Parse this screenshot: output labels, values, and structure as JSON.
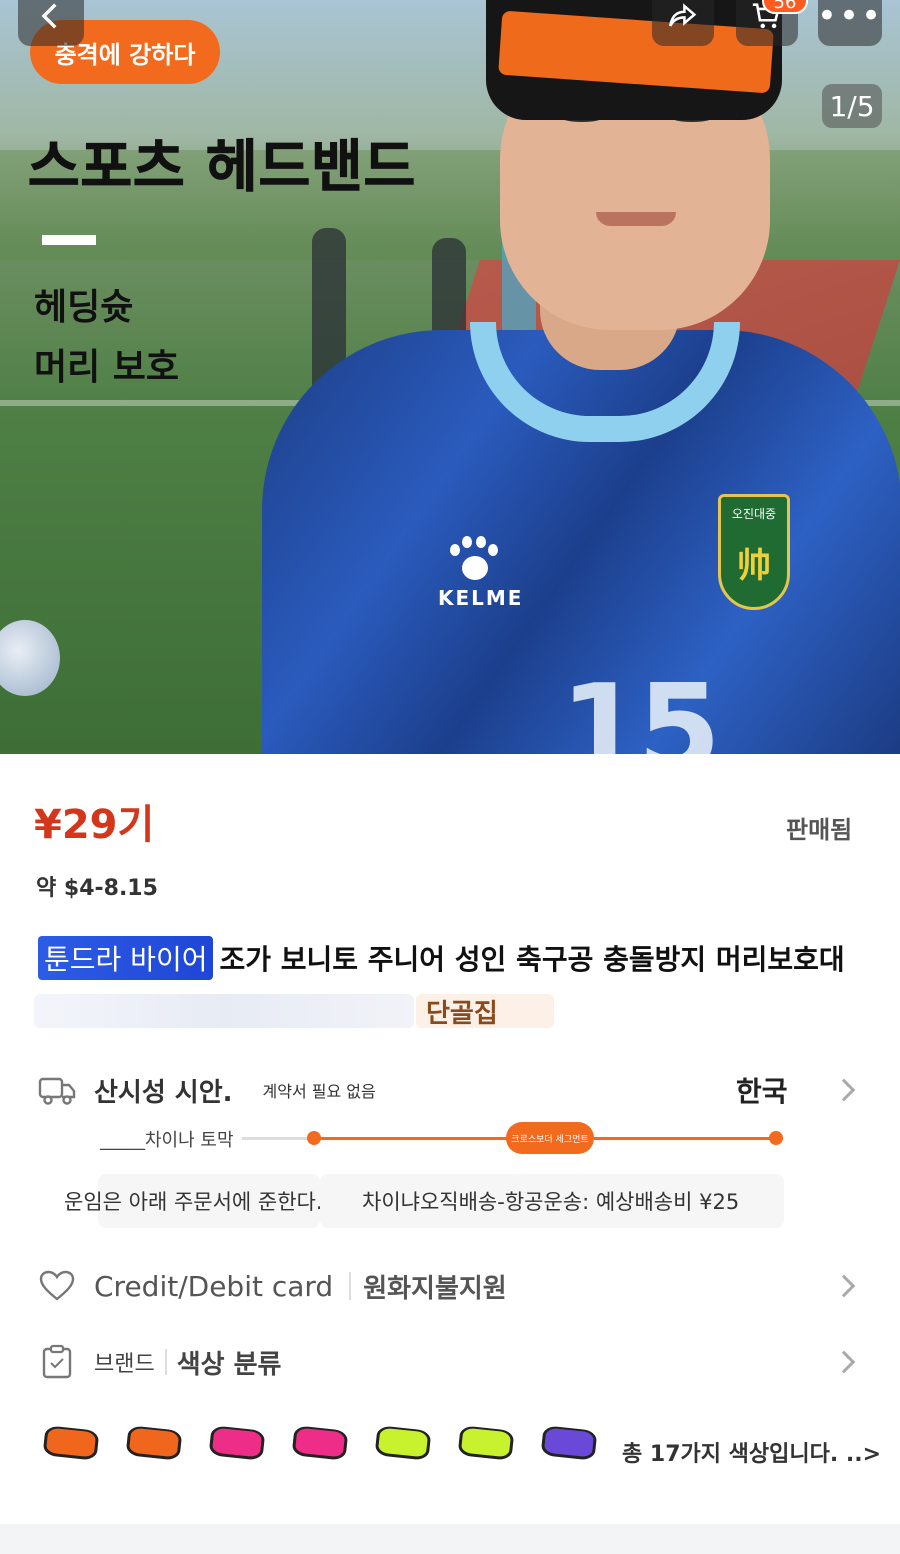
{
  "hero": {
    "badge": "충격에 강하다",
    "title": "스포츠 헤드밴드",
    "line1": "헤딩슛",
    "line2": "머리 보호",
    "pager": "1/5",
    "cart_count": "56",
    "jersey_brand": "KELME",
    "crest_text": "오진대중",
    "jersey_number": "15"
  },
  "product": {
    "price": "¥29기",
    "sold": "판매됨",
    "approx": "약 $4-8.15",
    "title_tag": "툰드라 바이어",
    "title": "조가 보니토 주니어 성인 축구공 충돌방지 머리보호대",
    "tag2": "단골집"
  },
  "shipping": {
    "title": "산시성 시안.",
    "note": "계약서 필요 없음",
    "destination": "한국",
    "from_label": "_____차이나 토막",
    "segment_label": "크로스보더 세그먼트",
    "fee_note": "운임은 아래 주문서에 준한다.",
    "method": "차이냐오직배송-항공운송: 예상배송비 ¥25"
  },
  "payment": {
    "method": "Credit/Debit card",
    "krw": "원화지불지원"
  },
  "brand": {
    "label": "브랜드",
    "value": "색상 분류"
  },
  "colors": {
    "count_text": "총 17가지 색상입니다. ..>",
    "swatches": [
      "#f0661c",
      "#f0661c",
      "#ee2d88",
      "#ee2d88",
      "#c7f22d",
      "#c7f22d",
      "#6b49d8"
    ]
  }
}
